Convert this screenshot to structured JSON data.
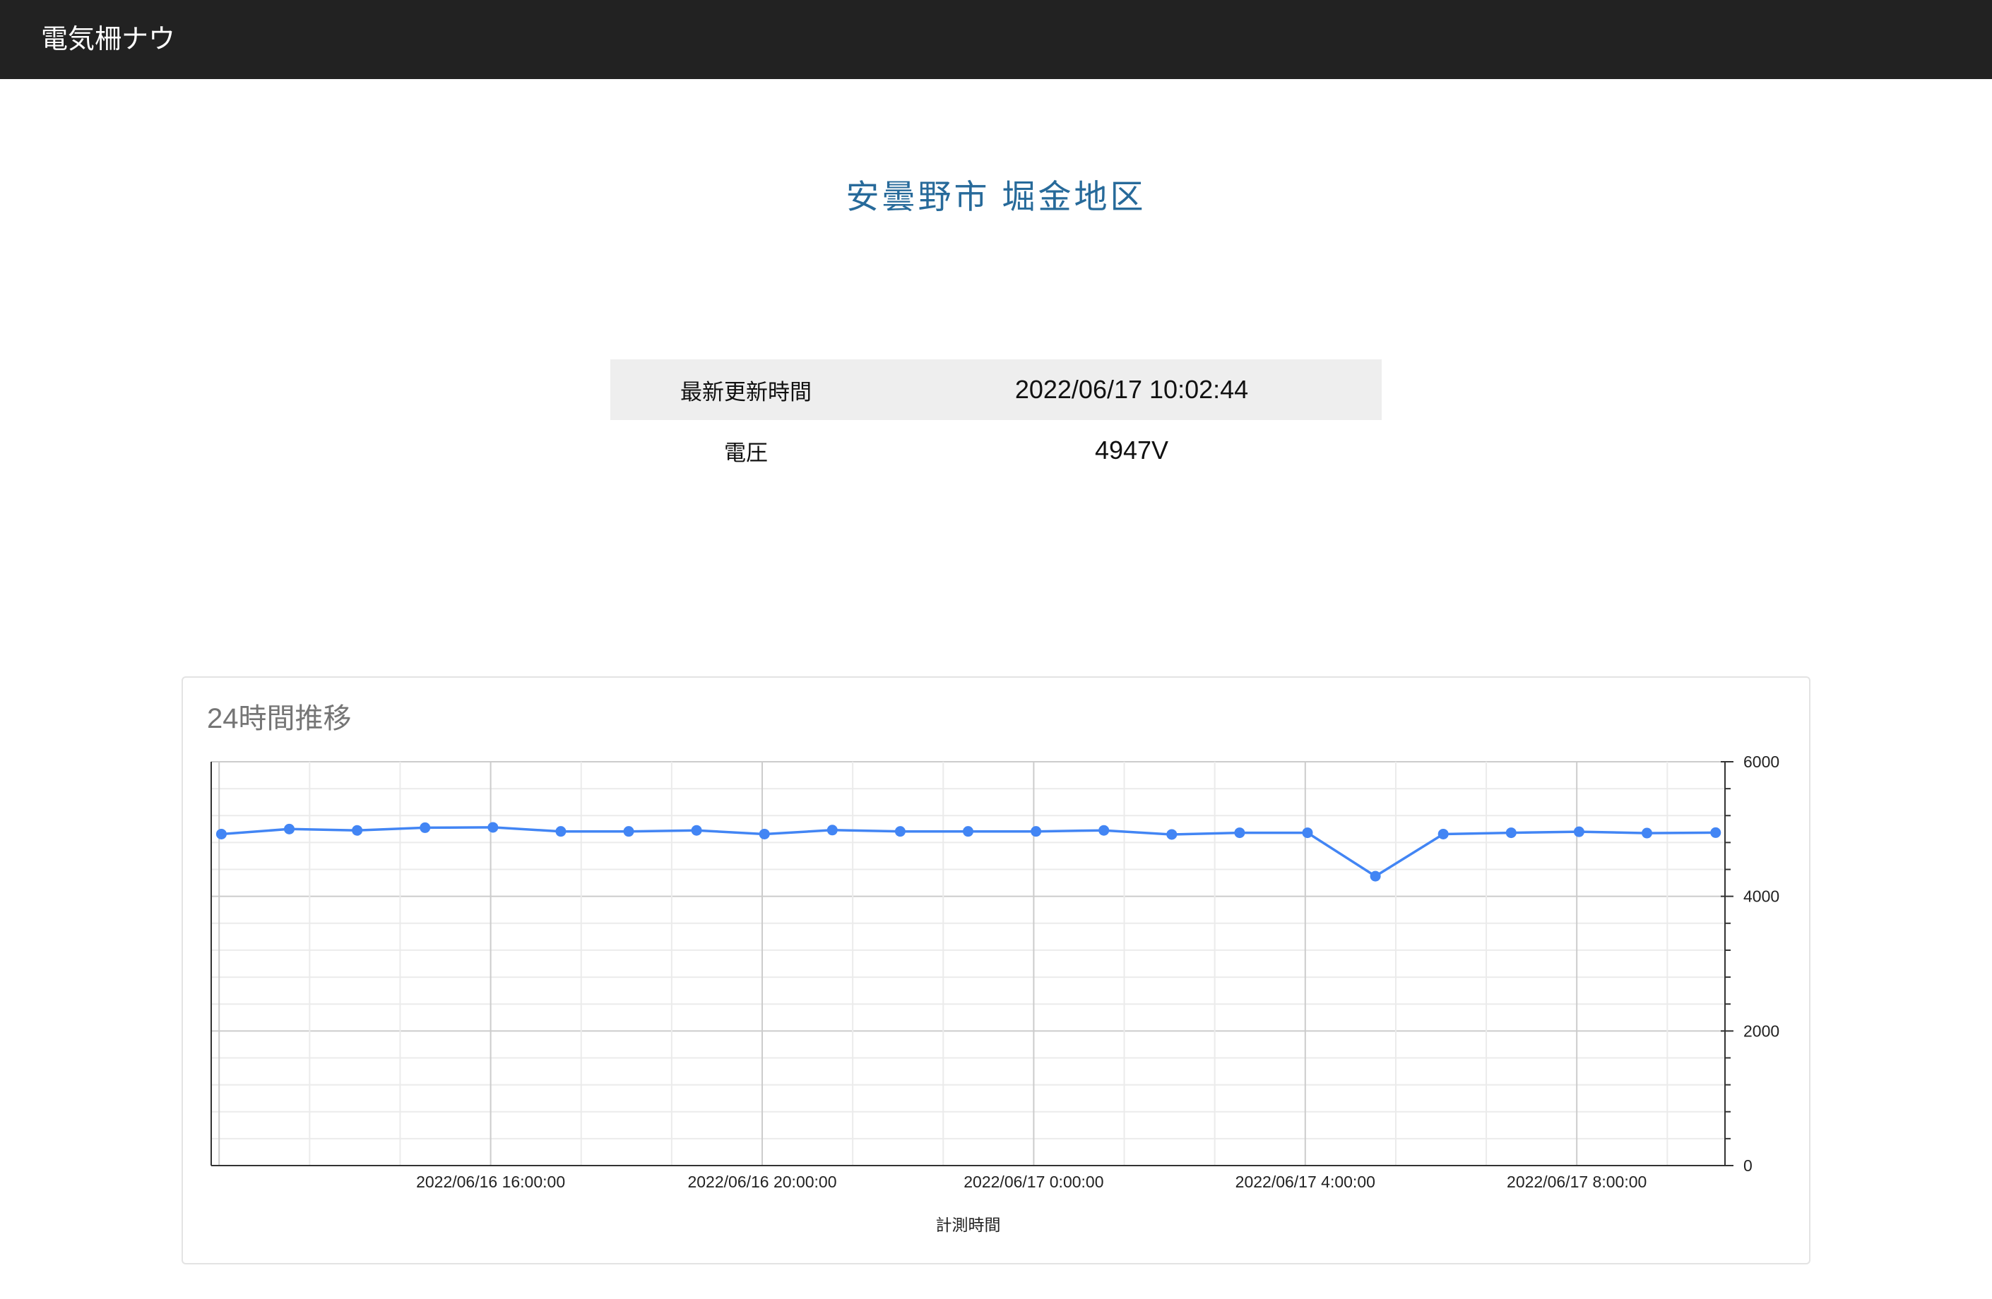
{
  "app": {
    "title": "電気柵ナウ"
  },
  "page": {
    "title": "安曇野市 堀金地区"
  },
  "status": {
    "rows": [
      {
        "label": "最新更新時間",
        "value": "2022/06/17 10:02:44"
      },
      {
        "label": "電圧",
        "value": "4947V"
      }
    ]
  },
  "colors": {
    "header_bg": "#222222",
    "header_text": "#ffffff",
    "page_title": "#276a9a",
    "row_highlight": "#eeeeee",
    "card_title": "#757575"
  },
  "chart_data": {
    "type": "line",
    "title": "24時間推移",
    "xlabel": "計測時間",
    "ylabel": "",
    "x_tick_labels": [
      "2022/06/16 16:00:00",
      "2022/06/16 20:00:00",
      "2022/06/17 0:00:00",
      "2022/06/17 4:00:00",
      "2022/06/17 8:00:00"
    ],
    "xlim": [
      "2022/06/16 11:53:00",
      "2022/06/17 10:11:00"
    ],
    "ylim": [
      0,
      6000
    ],
    "yticks": [
      0,
      2000,
      4000,
      6000
    ],
    "y_axis_side": "right",
    "grid": true,
    "legend": "none",
    "markers": true,
    "series": [
      {
        "color": "#4285f4",
        "x": [
          "2022/06/16 12:02:00",
          "2022/06/16 13:02:00",
          "2022/06/16 14:02:00",
          "2022/06/16 15:02:00",
          "2022/06/16 16:02:00",
          "2022/06/16 17:02:00",
          "2022/06/16 18:02:00",
          "2022/06/16 19:02:00",
          "2022/06/16 20:02:00",
          "2022/06/16 21:02:00",
          "2022/06/16 22:02:00",
          "2022/06/16 23:02:00",
          "2022/06/17 0:02:00",
          "2022/06/17 1:02:00",
          "2022/06/17 2:02:00",
          "2022/06/17 3:02:00",
          "2022/06/17 4:02:00",
          "2022/06/17 5:02:00",
          "2022/06/17 6:02:00",
          "2022/06/17 7:02:00",
          "2022/06/17 8:02:00",
          "2022/06/17 9:02:00",
          "2022/06/17 10:02:44"
        ],
        "y": [
          4925,
          5000,
          4980,
          5020,
          5025,
          4965,
          4965,
          4980,
          4925,
          4985,
          4965,
          4965,
          4965,
          4980,
          4920,
          4945,
          4945,
          4300,
          4925,
          4945,
          4960,
          4940,
          4947
        ]
      }
    ]
  }
}
